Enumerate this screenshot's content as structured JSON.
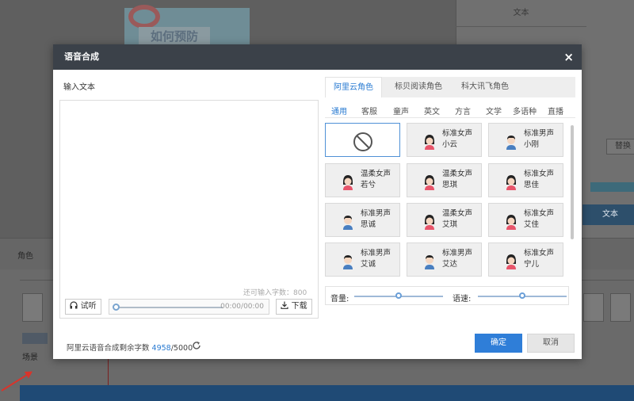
{
  "background": {
    "thumbnail_text": "如何预防",
    "right_tab": "文本",
    "replace_button": "替换",
    "text_button": "文本",
    "role_label": "角色",
    "scene_label": "场景"
  },
  "dialog": {
    "title": "语音合成",
    "close_glyph": "×",
    "input_label": "输入文本",
    "textarea_value": "",
    "remaining_input_hint": "还可输入字数：800",
    "listen_label": "试听",
    "time_display": "00:00/00:00",
    "download_label": "下载",
    "provider_tabs": [
      "阿里云角色",
      "标贝阅读角色",
      "科大讯飞角色"
    ],
    "active_provider": 0,
    "category_tabs": [
      "通用",
      "客服",
      "童声",
      "英文",
      "方言",
      "文学",
      "多语种",
      "直播"
    ],
    "active_category": 0,
    "voices": [
      {
        "line1": "",
        "line2": "",
        "gender": "none"
      },
      {
        "line1": "标准女声",
        "line2": "小云",
        "gender": "female"
      },
      {
        "line1": "标准男声",
        "line2": "小刚",
        "gender": "male"
      },
      {
        "line1": "温柔女声",
        "line2": "若兮",
        "gender": "female"
      },
      {
        "line1": "温柔女声",
        "line2": "思琪",
        "gender": "female"
      },
      {
        "line1": "标准女声",
        "line2": "思佳",
        "gender": "female"
      },
      {
        "line1": "标准男声",
        "line2": "思诚",
        "gender": "male"
      },
      {
        "line1": "温柔女声",
        "line2": "艾琪",
        "gender": "female"
      },
      {
        "line1": "标准女声",
        "line2": "艾佳",
        "gender": "female"
      },
      {
        "line1": "标准男声",
        "line2": "艾诚",
        "gender": "male"
      },
      {
        "line1": "标准男声",
        "line2": "艾达",
        "gender": "male"
      },
      {
        "line1": "标准女声",
        "line2": "宁儿",
        "gender": "female"
      }
    ],
    "volume_label": "音量:",
    "volume_level": 0.5,
    "speed_label": "语速:",
    "speed_level": 0.5,
    "footer_prefix": "阿里云语音合成剩余字数",
    "footer_remaining": "4958",
    "footer_total": "/5000",
    "ok_label": "确定",
    "cancel_label": "取消",
    "accent_color": "#2f7ed8"
  }
}
